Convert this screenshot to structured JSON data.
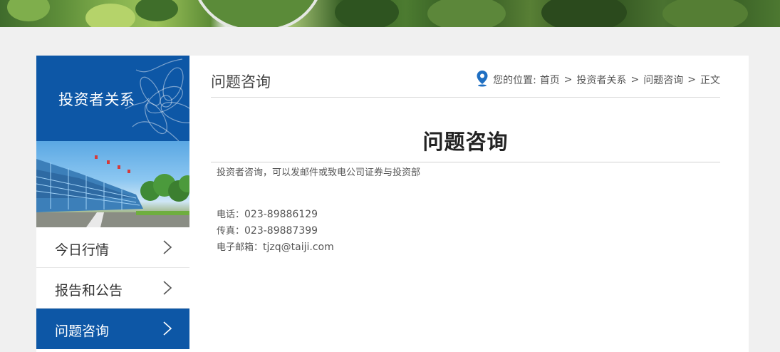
{
  "colors": {
    "brand_blue": "#0d57a6",
    "page_bg": "#f0f0f0",
    "pin_blue": "#1f6fc2"
  },
  "sidebar": {
    "section_title": "投资者关系",
    "items": [
      {
        "label": "今日行情",
        "active": false
      },
      {
        "label": "报告和公告",
        "active": false
      },
      {
        "label": "问题咨询",
        "active": true
      }
    ]
  },
  "main": {
    "page_heading": "问题咨询",
    "breadcrumb": {
      "prefix": "您的位置:",
      "items": [
        "首页",
        "投资者关系",
        "问题咨询",
        "正文"
      ],
      "separator": ">"
    },
    "article": {
      "title": "问题咨询",
      "intro": "投资者咨询，可以发邮件或致电公司证券与投资部",
      "contacts": [
        {
          "label": "电话：",
          "value": "023-89886129"
        },
        {
          "label": "传真：",
          "value": "023-89887399"
        },
        {
          "label": "电子邮箱：",
          "value": "tjzq@taiji.com"
        }
      ]
    }
  },
  "icons": {
    "breadcrumb": "location-pin-icon",
    "nav": "chevron-right-icon"
  }
}
